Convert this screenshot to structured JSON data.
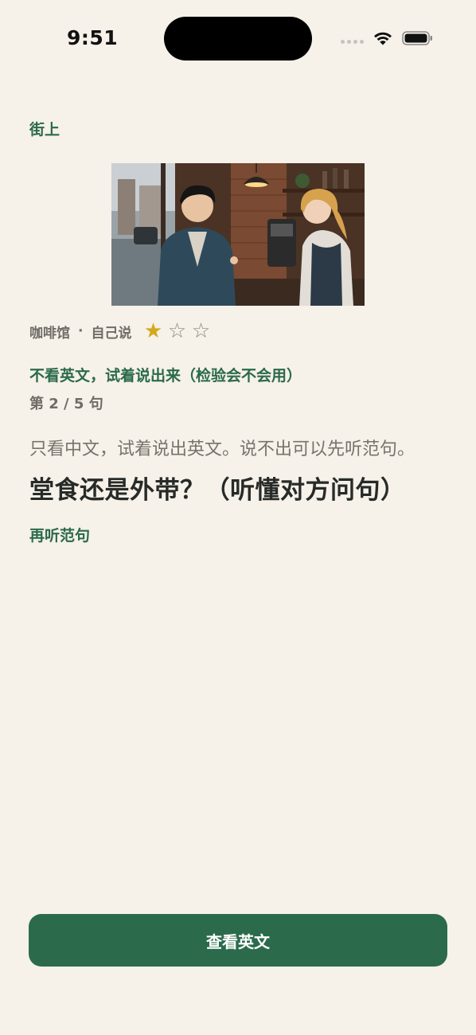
{
  "status_bar": {
    "time": "9:51"
  },
  "scene": {
    "label": "街上",
    "image_icon": "cafe-scene-illustration"
  },
  "meta": {
    "location": "咖啡馆",
    "separator": "·",
    "mode": "自己说",
    "stars_filled": 1,
    "stars_total": 3,
    "star_filled_glyph": "★",
    "star_empty_glyph": "☆"
  },
  "task": {
    "title": "不看英文，试着说出来（检验会不会用）",
    "progress": "第 2 / 5 句",
    "instruction": "只看中文，试着说出英文。说不出可以先听范句。",
    "prompt": "堂食还是外带？（听懂对方问句）",
    "replay_label": "再听范句"
  },
  "actions": {
    "reveal_label": "查看英文"
  },
  "colors": {
    "background": "#f6f1e9",
    "accent": "#2a6a4b",
    "button": "#2b6b4c",
    "star": "#d4a91c",
    "muted": "#6f6c66"
  }
}
